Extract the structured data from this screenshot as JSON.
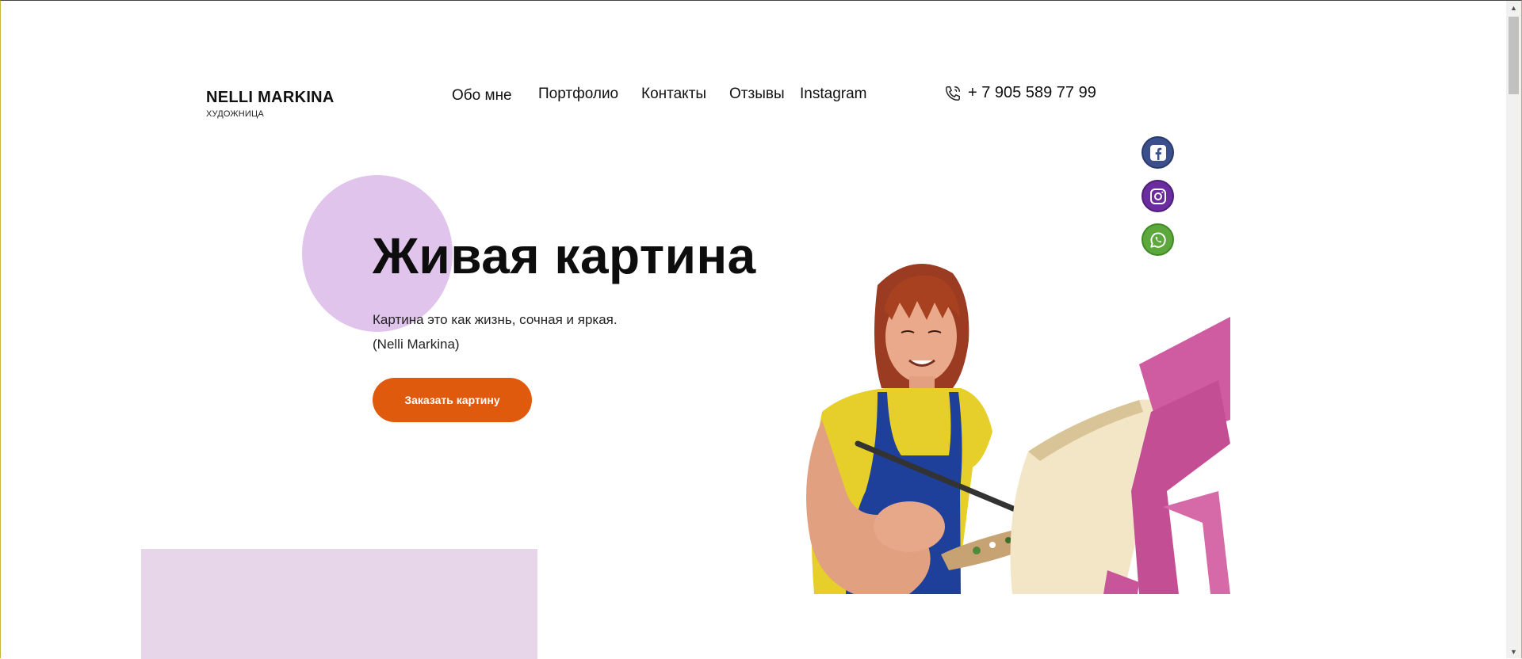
{
  "header": {
    "logo_name": "NELLI MARKINA",
    "logo_subtitle": "ХУДОЖНИЦА",
    "nav": [
      {
        "label": "Обо мне"
      },
      {
        "label": "Портфолио"
      },
      {
        "label": "Контакты"
      },
      {
        "label": "Отзывы"
      },
      {
        "label": "Instagram"
      }
    ],
    "phone": "+ 7 905 589 77 99",
    "phone_icon": "phone-icon"
  },
  "social": [
    {
      "name": "facebook-icon",
      "color": "#3b4f8c"
    },
    {
      "name": "instagram-icon",
      "color": "#6a2c9e"
    },
    {
      "name": "whatsapp-icon",
      "color": "#5da83c"
    }
  ],
  "hero": {
    "title": "Живая картина",
    "quote_line1": "Картина это как жизнь, сочная и яркая.",
    "quote_line2": "(Nelli Markina)",
    "cta_label": "Заказать картину"
  },
  "colors": {
    "accent": "#e05a0d",
    "circle": "#e0c4ec",
    "block": "#e7d6ea"
  },
  "scrollbar": {
    "up_glyph": "▲",
    "down_glyph": "▼"
  }
}
